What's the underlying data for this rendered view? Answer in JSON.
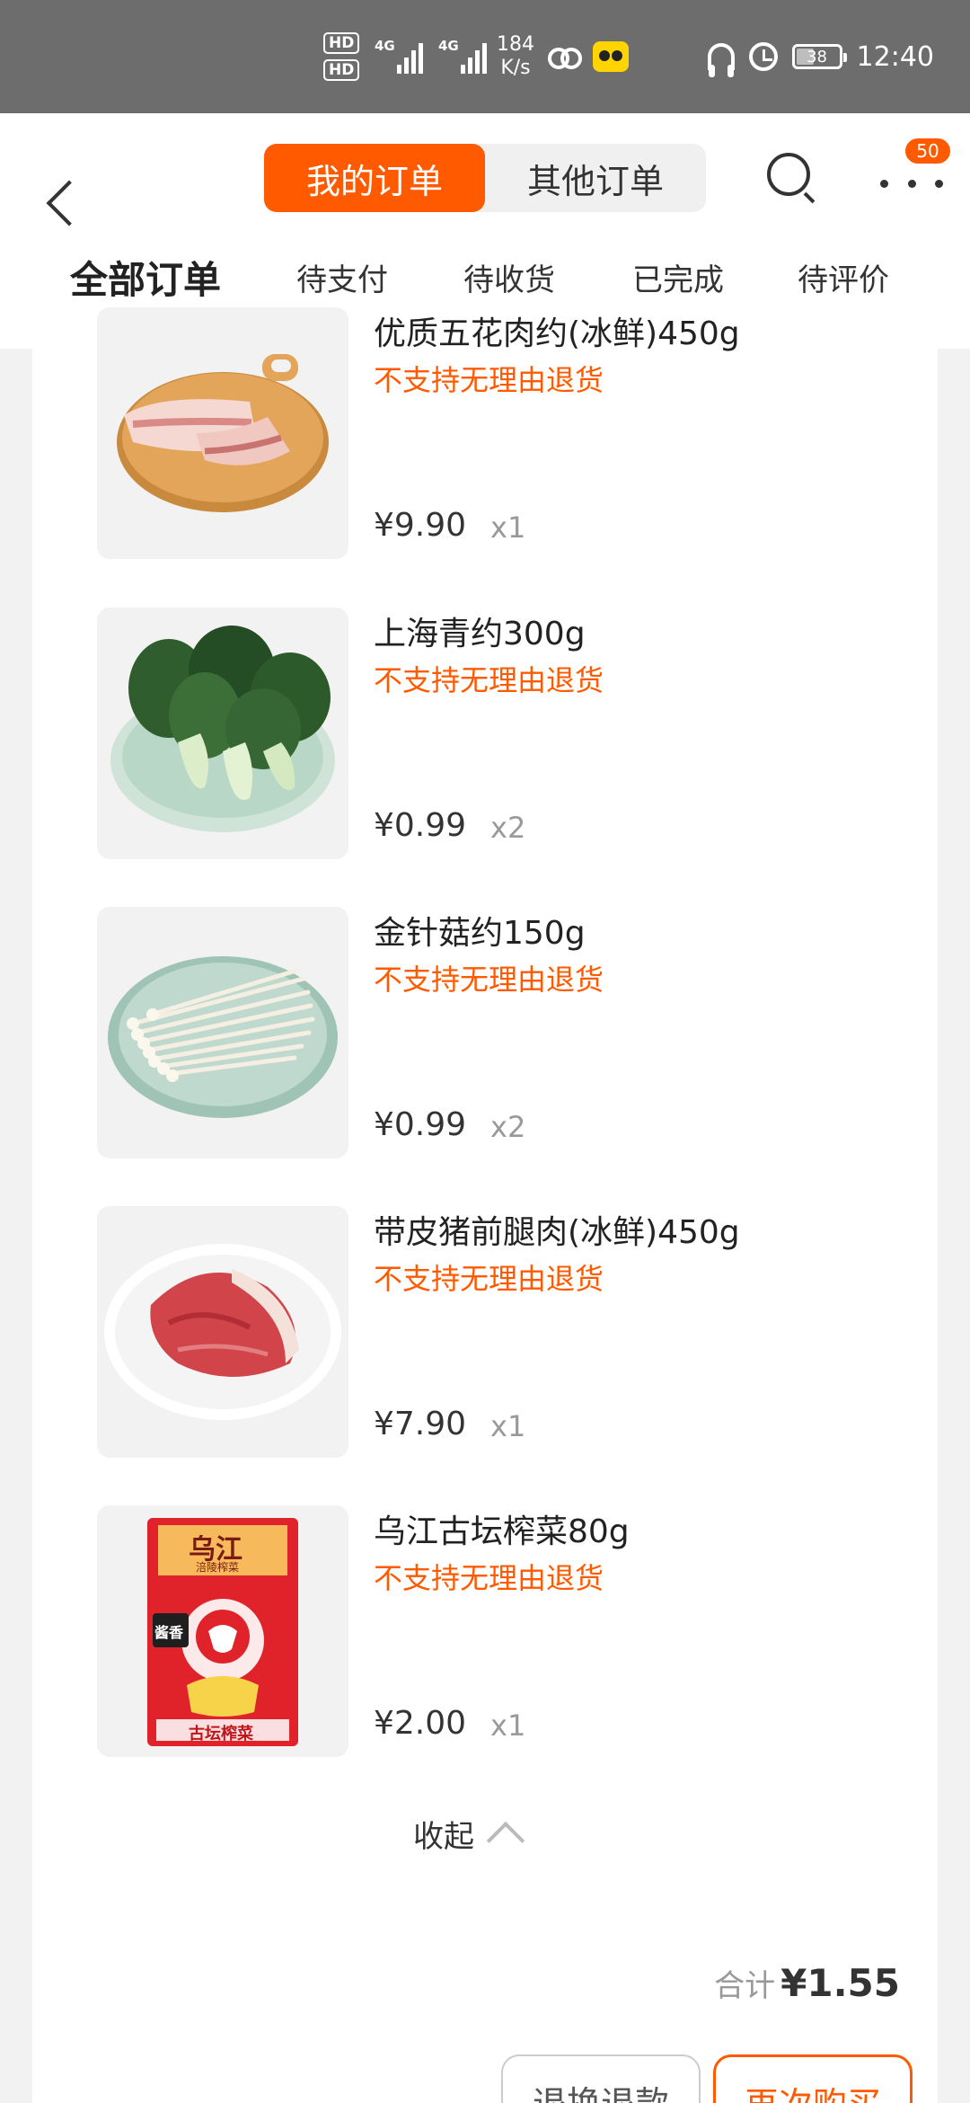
{
  "status_bar": {
    "hd1": "HD",
    "hd2": "HD",
    "net1": "4G",
    "net2": "4G",
    "speed_value": "184",
    "speed_unit": "K/s",
    "battery": "38",
    "time": "12:40"
  },
  "header": {
    "segments": [
      "我的订单",
      "其他订单"
    ],
    "active_segment": "我的订单",
    "badge_count": "50"
  },
  "tabs": [
    "全部订单",
    "待支付",
    "待收货",
    "已完成",
    "待评价"
  ],
  "active_tab": "全部订单",
  "products": [
    {
      "name": "优质五花肉约(冰鲜)450g",
      "note": "不支持无理由退货",
      "price": "¥9.90",
      "qty": "x1",
      "image": "pork-belly-on-board"
    },
    {
      "name": "上海青约300g",
      "note": "不支持无理由退货",
      "price": "¥0.99",
      "qty": "x2",
      "image": "bok-choy-plate"
    },
    {
      "name": "金针菇约150g",
      "note": "不支持无理由退货",
      "price": "¥0.99",
      "qty": "x2",
      "image": "enoki-mushroom-plate"
    },
    {
      "name": "带皮猪前腿肉(冰鲜)450g",
      "note": "不支持无理由退货",
      "price": "¥7.90",
      "qty": "x1",
      "image": "pork-leg-plate"
    },
    {
      "name": "乌江古坛榨菜80g",
      "note": "不支持无理由退货",
      "price": "¥2.00",
      "qty": "x1",
      "image": "pickle-package"
    }
  ],
  "package_text": {
    "brand": "乌江",
    "sub": "涪陵榨菜",
    "tag": "酱香",
    "bottom": "古坛榨菜"
  },
  "collapse_label": "收起",
  "total": {
    "label": "合计",
    "value": "¥1.55"
  },
  "actions": {
    "refund": "退换退款",
    "rebuy": "再次购买"
  },
  "colors": {
    "accent": "#ff5a00",
    "status_bar": "#6d6d6d"
  }
}
